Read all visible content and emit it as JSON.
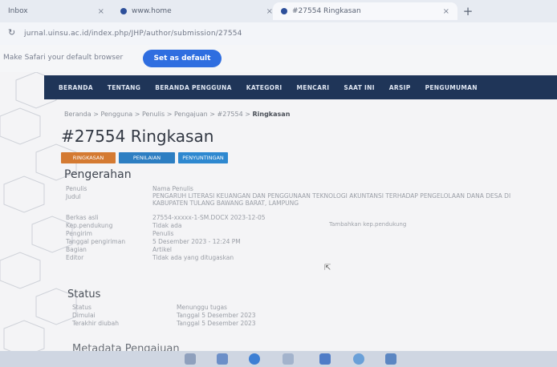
{
  "browser": {
    "tabs": [
      {
        "label": "Inbox"
      },
      {
        "label": "www.home"
      },
      {
        "label": "#27554 Ringkasan"
      }
    ],
    "new_tab_symbol": "+",
    "url": "jurnal.uinsu.ac.id/index.php/JHP/author/submission/27554",
    "infobar_message": "Make Safari your default browser",
    "infobar_button": "Set as default"
  },
  "nav": {
    "items": [
      "BERANDA",
      "TENTANG",
      "BERANDA PENGGUNA",
      "KATEGORI",
      "MENCARI",
      "SAAT INI",
      "ARSIP",
      "PENGUMUMAN"
    ]
  },
  "breadcrumb": {
    "prefix": "Beranda > Pengguna > Penulis > Pengajuan > #27554 >",
    "current": "Ringkasan"
  },
  "page": {
    "title": "#27554 Ringkasan",
    "buttons": [
      "RINGKASAN",
      "PENILAIAN",
      "PENYUNTINGAN"
    ]
  },
  "submission": {
    "heading": "Pengerahan",
    "rows": [
      {
        "label": "Penulis",
        "value": "Nama Penulis"
      },
      {
        "label": "Judul",
        "value": "PENGARUH LITERASI KEUANGAN DAN PENGGUNAAN TEKNOLOGI AKUNTANSI TERHADAP PENGELOLAAN DANA DESA DI KABUPATEN TULANG BAWANG BARAT, LAMPUNG"
      },
      {
        "label": "Berkas asli",
        "value": "27554-xxxxx-1-SM.DOCX    2023-12-05"
      },
      {
        "label": "Kep.pendukung",
        "value": "Tidak ada",
        "note": "Tambahkan kep.pendukung"
      },
      {
        "label": "Pengirim",
        "value": "Penulis"
      },
      {
        "label": "Tanggal pengiriman",
        "value": "5 Desember 2023 - 12:24 PM"
      },
      {
        "label": "Bagian",
        "value": "Artikel"
      },
      {
        "label": "Editor",
        "value": "Tidak ada yang ditugaskan"
      }
    ]
  },
  "status": {
    "heading": "Status",
    "rows": [
      {
        "label": "Status",
        "value": "Menunggu tugas"
      },
      {
        "label": "Dimulai",
        "value": "Tanggal 5 Desember 2023"
      },
      {
        "label": "Terakhir diubah",
        "value": "Tanggal 5 Desember 2023"
      }
    ]
  },
  "metadata": {
    "heading": "Metadata Pengajuan"
  }
}
